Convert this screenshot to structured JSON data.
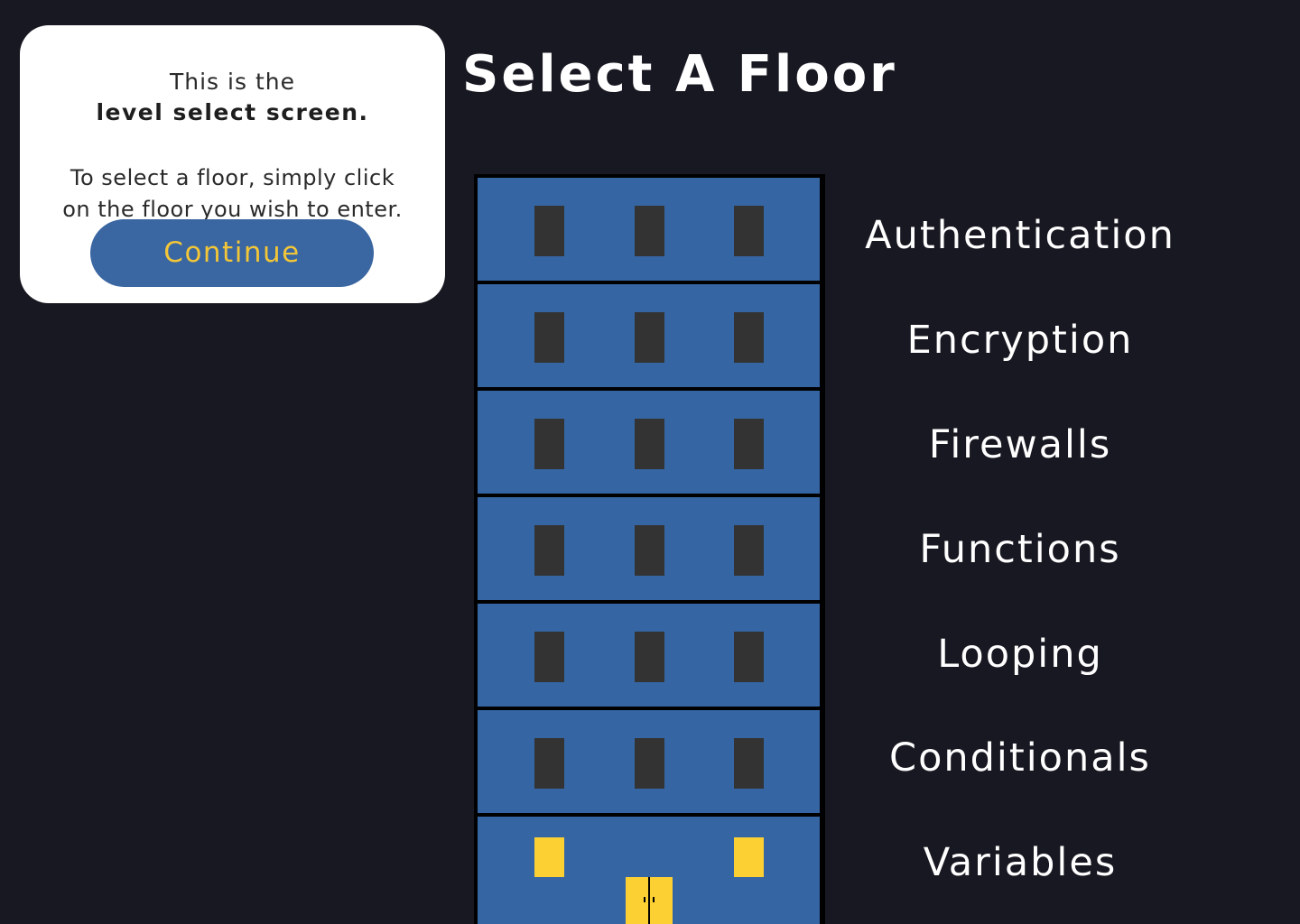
{
  "tooltip": {
    "line1": "This is the",
    "line2": "level select screen.",
    "body_line1": "To select a floor, simply click",
    "body_line2": "on the floor you wish to enter.",
    "continue_label": "Continue"
  },
  "title": "Select A Floor",
  "floors": [
    {
      "label": "Authentication"
    },
    {
      "label": "Encryption"
    },
    {
      "label": "Firewalls"
    },
    {
      "label": "Functions"
    },
    {
      "label": "Looping"
    },
    {
      "label": "Conditionals"
    },
    {
      "label": "Variables"
    }
  ],
  "colors": {
    "background": "#181822",
    "floor": "#3566a3",
    "window_dark": "#333333",
    "window_lit": "#fcd033",
    "button": "#3a66a1",
    "button_text": "#f2c638"
  }
}
